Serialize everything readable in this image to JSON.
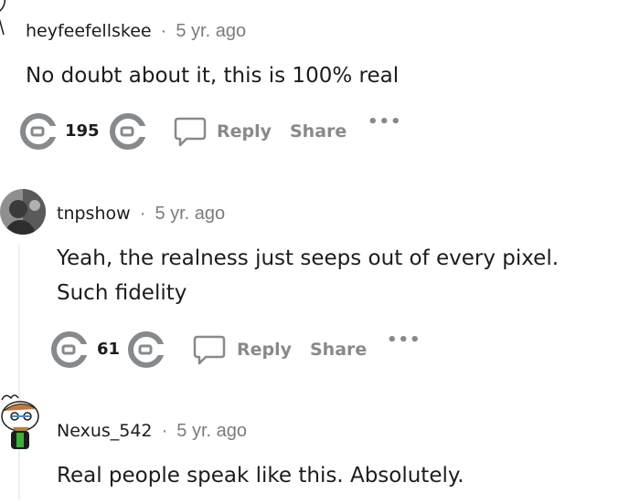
{
  "comments": [
    {
      "username": "heyfeefellskee",
      "separator": "·",
      "time": "5 yr. ago",
      "text_lines": [
        "No doubt about it, this is 100% real"
      ],
      "score": "195",
      "reply_label": "Reply",
      "share_label": "Share",
      "more_label": "•••"
    },
    {
      "username": "tnpshow",
      "separator": "·",
      "time": "5 yr. ago",
      "text_lines": [
        "Yeah, the realness just seeps out of every pixel.",
        "Such fidelity"
      ],
      "score": "61",
      "reply_label": "Reply",
      "share_label": "Share",
      "more_label": "•••"
    },
    {
      "username": "Nexus_542",
      "separator": "·",
      "time": "5 yr. ago",
      "text_lines": [
        "Real people speak like this. Absolutely."
      ]
    }
  ],
  "colors": {
    "text": "#1c1c1c",
    "meta": "#7c7c7c",
    "action": "#878a8c",
    "thread_line": "#edeff1"
  }
}
